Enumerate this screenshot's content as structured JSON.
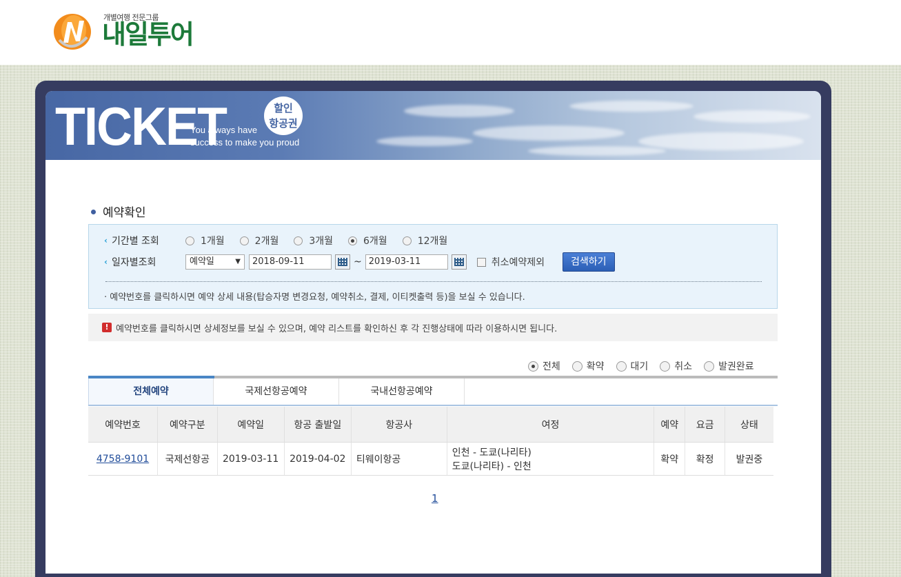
{
  "brand": {
    "tagline": "개별여행 전문그룹",
    "name": "내일투어"
  },
  "banner": {
    "title": "TICKET",
    "slogan_line1": "You always have",
    "slogan_line2": "success to make you proud",
    "badge_line1": "할인",
    "badge_line2": "항공권"
  },
  "section": {
    "title": "예약확인"
  },
  "search": {
    "period_label": "기간별 조회",
    "period_options": [
      {
        "label": "1개월",
        "selected": false
      },
      {
        "label": "2개월",
        "selected": false
      },
      {
        "label": "3개월",
        "selected": false
      },
      {
        "label": "6개월",
        "selected": true
      },
      {
        "label": "12개월",
        "selected": false
      }
    ],
    "date_label": "일자별조회",
    "date_type": "예약일",
    "start_date": "2018-09-11",
    "tilde": "~",
    "end_date": "2019-03-11",
    "exclude_cancel_label": "취소예약제외",
    "search_button": "검색하기",
    "note": "· 예약번호를 클릭하시면 예약 상세 내용(탑승자명 변경요청, 예약취소, 결제, 이티켓출력 등)을 보실 수 있습니다."
  },
  "alert": {
    "icon": "!",
    "text": "예약번호를 클릭하시면 상세정보를 보실 수 있으며, 예약 리스트를 확인하신 후 각 진행상태에 따라 이용하시면 됩니다."
  },
  "status_filter": [
    {
      "label": "전체",
      "selected": true
    },
    {
      "label": "확약",
      "selected": false
    },
    {
      "label": "대기",
      "selected": false
    },
    {
      "label": "취소",
      "selected": false
    },
    {
      "label": "발권완료",
      "selected": false
    }
  ],
  "tabs": [
    "전체예약",
    "국제선항공예약",
    "국내선항공예약"
  ],
  "table": {
    "headers": [
      "예약번호",
      "예약구분",
      "예약일",
      "항공 출발일",
      "항공사",
      "여정",
      "예약",
      "요금",
      "상태"
    ],
    "rows": [
      {
        "booking_no": "4758-9101",
        "type": "국제선항공",
        "booking_date": "2019-03-11",
        "departure": "2019-04-02",
        "airline": "티웨이항공",
        "itinerary_line1": "인천 - 도쿄(나리타)",
        "itinerary_line2": "도쿄(나리타) - 인천",
        "reservation": "확약",
        "fare": "확정",
        "status": "발권중"
      }
    ]
  },
  "pagination": {
    "current": "1"
  },
  "colors": {
    "frame": "#363c60",
    "accent_blue": "#2c5fb6",
    "brand_green": "#1d7a3a",
    "brand_orange": "#f28c1c"
  }
}
